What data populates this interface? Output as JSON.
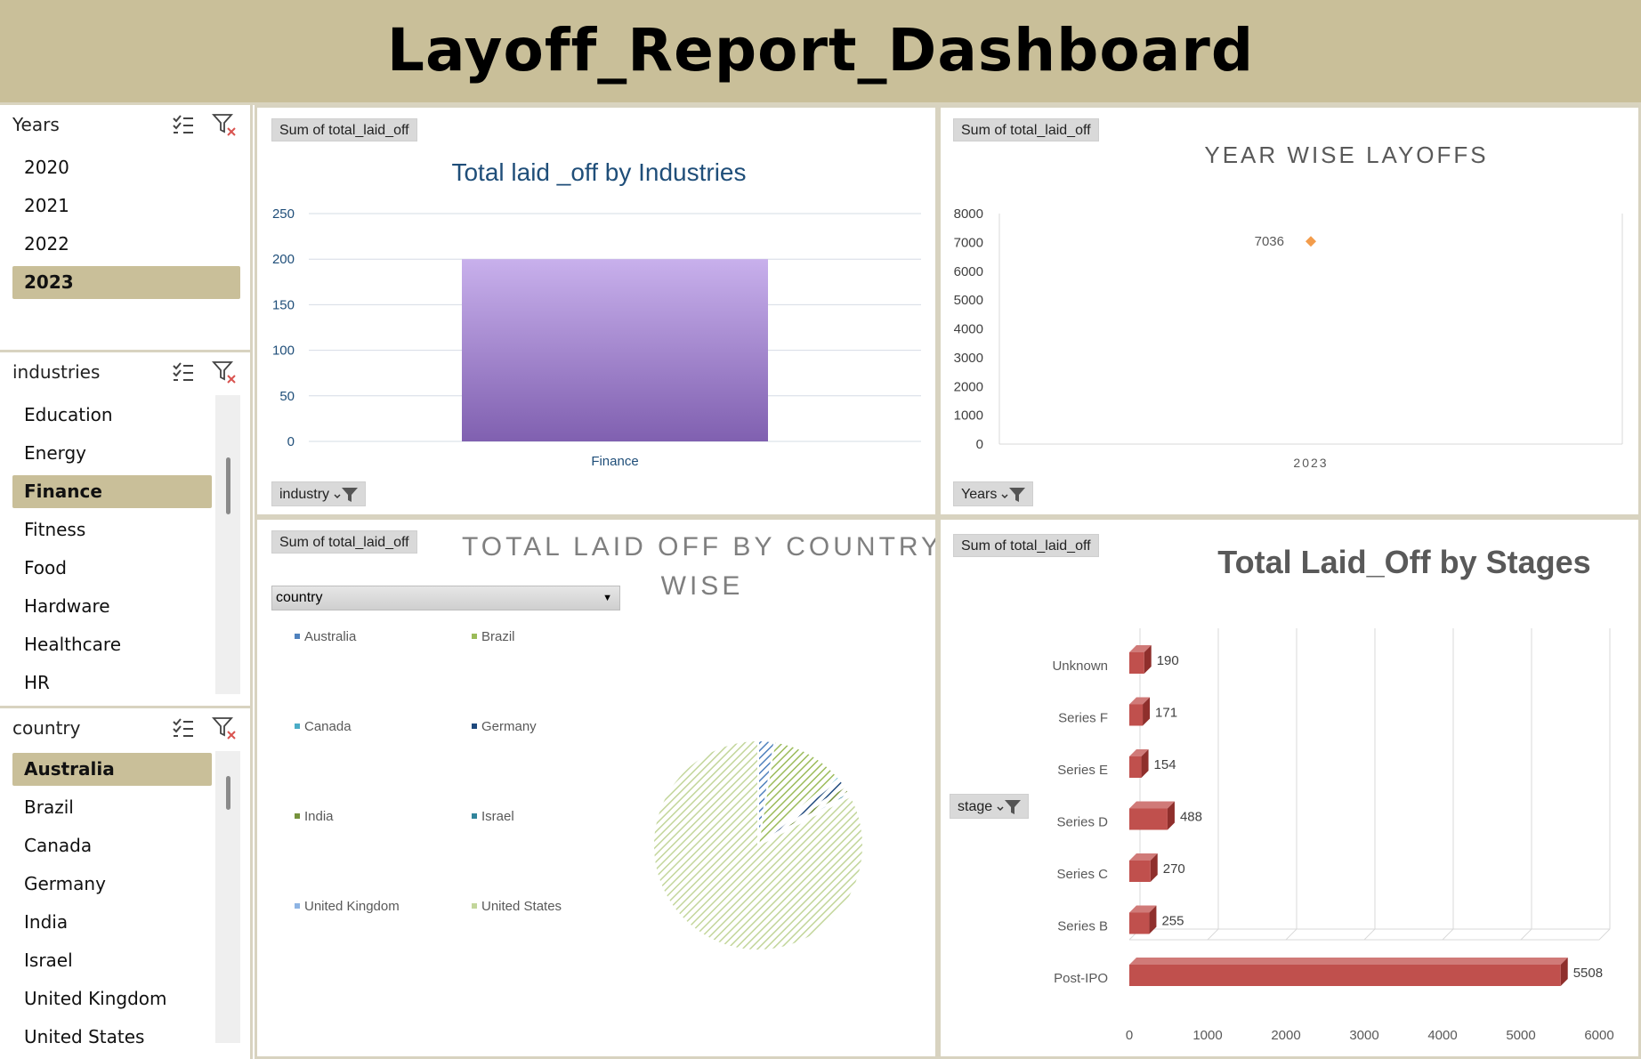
{
  "header": {
    "title": "Layoff_Report_Dashboard"
  },
  "slicers": {
    "years": {
      "title": "Years",
      "items": [
        "2020",
        "2021",
        "2022",
        "2023"
      ],
      "selected": "2023"
    },
    "industries": {
      "title": "industries",
      "items": [
        "Education",
        "Energy",
        "Finance",
        "Fitness",
        "Food",
        "Hardware",
        "Healthcare",
        "HR"
      ],
      "selected": "Finance"
    },
    "country": {
      "title": "country",
      "items": [
        "Australia",
        "Brazil",
        "Canada",
        "Germany",
        "India",
        "Israel",
        "United Kingdom",
        "United States"
      ],
      "selected": "Australia"
    }
  },
  "panels": {
    "industries_chart": {
      "field_label": "Sum of total_laid_off",
      "filter_label": "industry"
    },
    "year_chart": {
      "field_label": "Sum of total_laid_off",
      "filter_label": "Years"
    },
    "country_chart": {
      "field_label": "Sum of total_laid_off",
      "dropdown_label": "country"
    },
    "stages_chart": {
      "field_label": "Sum of total_laid_off",
      "filter_label": "stage"
    }
  },
  "colors": {
    "accent": "#c9bf99",
    "bar_purple_top": "#c8b0ec",
    "bar_purple_bottom": "#8060b0",
    "stage_bar": "#c0504d",
    "point_orange": "#f39c4b",
    "title_blue": "#1f4e79"
  },
  "chart_data": [
    {
      "type": "bar",
      "title": "Total laid _off by Industries",
      "categories": [
        "Finance"
      ],
      "values": [
        200
      ],
      "ylim": [
        0,
        250
      ],
      "yticks": [
        0,
        50,
        100,
        150,
        200,
        250
      ],
      "grid": true
    },
    {
      "type": "scatter",
      "title": "YEAR WISE LAYOFFS",
      "x": [
        "2023"
      ],
      "y": [
        7036
      ],
      "data_labels": [
        "7036"
      ],
      "ylim": [
        0,
        8000
      ],
      "yticks": [
        0,
        1000,
        2000,
        3000,
        4000,
        5000,
        6000,
        7000,
        8000
      ]
    },
    {
      "type": "pie",
      "title": "TOTAL LAID OFF BY COUNTRY WISE",
      "legend": [
        "Australia",
        "Brazil",
        "Canada",
        "Germany",
        "India",
        "Israel",
        "United Kingdom",
        "United States"
      ],
      "legend_colors": [
        "#4f81bd",
        "#9bbb59",
        "#4bacc6",
        "#1f497d",
        "#76923c",
        "#31859c",
        "#8eb4e3",
        "#c3d69b"
      ],
      "values": [
        2.5,
        11,
        0.5,
        1.5,
        1,
        0.4,
        0.3,
        82.8
      ],
      "legend_position": "left"
    },
    {
      "type": "bar",
      "orientation": "horizontal",
      "title": "Total Laid_Off by Stages",
      "categories": [
        "Unknown",
        "Series F",
        "Series E",
        "Series D",
        "Series C",
        "Series B",
        "Post-IPO"
      ],
      "values": [
        190,
        171,
        154,
        488,
        270,
        255,
        5508
      ],
      "xlim": [
        0,
        6000
      ],
      "xticks": [
        0,
        1000,
        2000,
        3000,
        4000,
        5000,
        6000
      ],
      "grid": true
    }
  ]
}
